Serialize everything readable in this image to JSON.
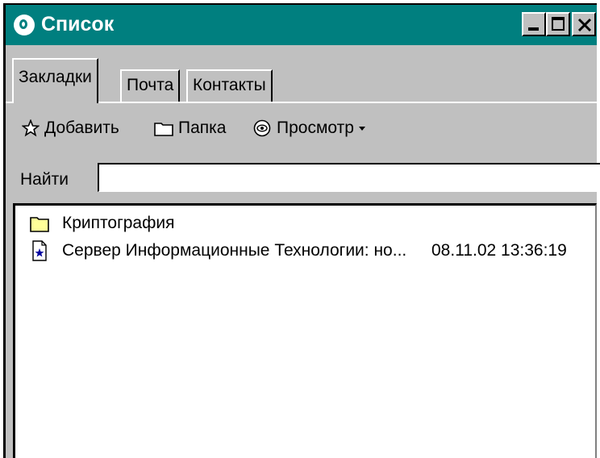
{
  "window": {
    "title": "Список",
    "controls": {
      "minimize": "minimize",
      "maximize": "maximize",
      "close": "close"
    }
  },
  "tabs": [
    {
      "label": "Закладки",
      "active": true
    },
    {
      "label": "Почта",
      "active": false
    },
    {
      "label": "Контакты",
      "active": false
    }
  ],
  "toolbar": {
    "add_label": "Добавить",
    "add_icon": "star-icon",
    "folder_label": "Папка",
    "folder_icon": "folder-icon",
    "view_label": "Просмотр",
    "view_icon": "eye-icon",
    "view_dropdown_icon": "chevron-down-icon"
  },
  "search": {
    "label": "Найти",
    "value": ""
  },
  "list": {
    "items": [
      {
        "type": "folder",
        "icon": "folder-icon",
        "title": "Криптография",
        "date": ""
      },
      {
        "type": "bookmark",
        "icon": "document-star-icon",
        "title": "Сервер Информационные Технологии: но...",
        "date": "08.11.02 13:36:19"
      }
    ]
  },
  "colors": {
    "titlebar": "#007f7f",
    "face": "#c0c0c0",
    "list_bg": "#ffffff"
  }
}
